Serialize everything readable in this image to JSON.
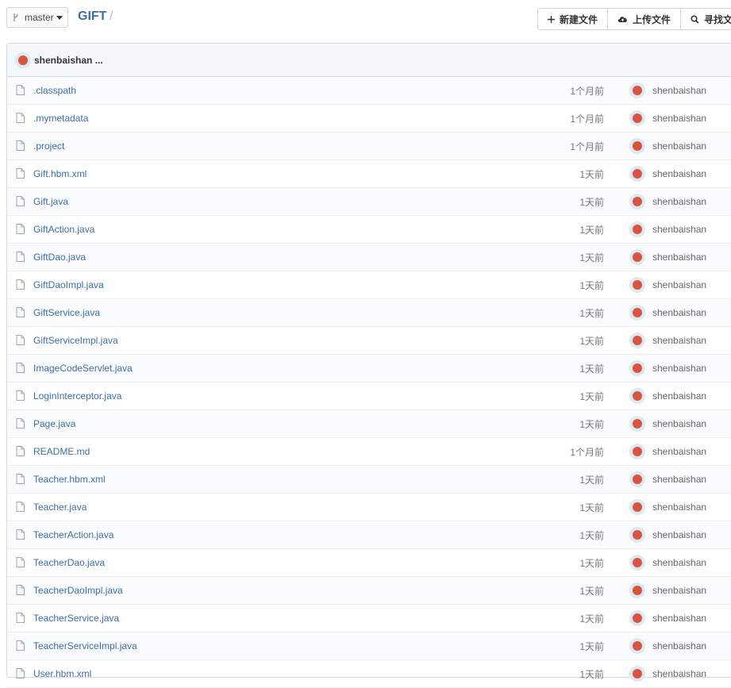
{
  "branch": {
    "label": "master"
  },
  "repo": {
    "title": "GIFT",
    "separator": "/"
  },
  "actions": {
    "new_file": "新建文件",
    "upload_file": "上传文件",
    "find_file": "寻找文"
  },
  "latest_commit": {
    "author": "shenbaishan ..."
  },
  "files": [
    {
      "name": ".classpath",
      "time": "1个月前",
      "author": "shenbaishan"
    },
    {
      "name": ".mymetadata",
      "time": "1个月前",
      "author": "shenbaishan"
    },
    {
      "name": ".project",
      "time": "1个月前",
      "author": "shenbaishan"
    },
    {
      "name": "Gift.hbm.xml",
      "time": "1天前",
      "author": "shenbaishan"
    },
    {
      "name": "Gift.java",
      "time": "1天前",
      "author": "shenbaishan"
    },
    {
      "name": "GiftAction.java",
      "time": "1天前",
      "author": "shenbaishan"
    },
    {
      "name": "GiftDao.java",
      "time": "1天前",
      "author": "shenbaishan"
    },
    {
      "name": "GiftDaoImpl.java",
      "time": "1天前",
      "author": "shenbaishan"
    },
    {
      "name": "GiftService.java",
      "time": "1天前",
      "author": "shenbaishan"
    },
    {
      "name": "GiftServiceImpl.java",
      "time": "1天前",
      "author": "shenbaishan"
    },
    {
      "name": "ImageCodeServlet.java",
      "time": "1天前",
      "author": "shenbaishan"
    },
    {
      "name": "LoginInterceptor.java",
      "time": "1天前",
      "author": "shenbaishan"
    },
    {
      "name": "Page.java",
      "time": "1天前",
      "author": "shenbaishan"
    },
    {
      "name": "README.md",
      "time": "1个月前",
      "author": "shenbaishan"
    },
    {
      "name": "Teacher.hbm.xml",
      "time": "1天前",
      "author": "shenbaishan"
    },
    {
      "name": "Teacher.java",
      "time": "1天前",
      "author": "shenbaishan"
    },
    {
      "name": "TeacherAction.java",
      "time": "1天前",
      "author": "shenbaishan"
    },
    {
      "name": "TeacherDao.java",
      "time": "1天前",
      "author": "shenbaishan"
    },
    {
      "name": "TeacherDaoImpl.java",
      "time": "1天前",
      "author": "shenbaishan"
    },
    {
      "name": "TeacherService.java",
      "time": "1天前",
      "author": "shenbaishan"
    },
    {
      "name": "TeacherServiceImpl.java",
      "time": "1天前",
      "author": "shenbaishan"
    },
    {
      "name": "User.hbm.xml",
      "time": "1天前",
      "author": "shenbaishan"
    }
  ]
}
